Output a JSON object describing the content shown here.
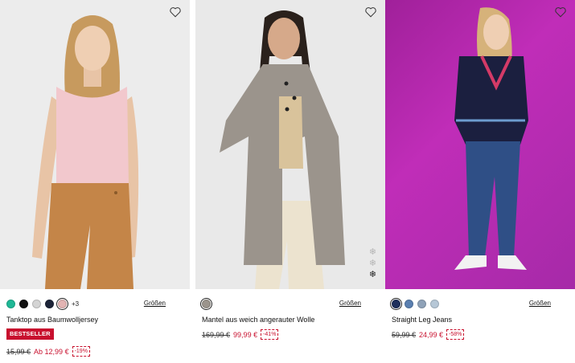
{
  "products": [
    {
      "name": "Tanktop aus Baumwolljersey",
      "image_alt": "Model in pink tank top and camel trousers",
      "swatches": [
        "#1fb896",
        "#111111",
        "#d4d4d4",
        "#1c2438",
        "#e2b4b3"
      ],
      "more_colors": "+3",
      "sizes_label": "Größen",
      "badge": "BESTSELLER",
      "old_price": "15,99 €",
      "new_price": "Ab 12,99 €",
      "discount": "-19%"
    },
    {
      "name": "Mantel aus weich angerauter Wolle",
      "image_alt": "Model in grey wool coat",
      "swatches": [
        "#9b948c"
      ],
      "more_colors": "",
      "sizes_label": "Größen",
      "badge": "",
      "old_price": "169,99 €",
      "new_price": "99,99 €",
      "discount": "-41%",
      "gallery_icons": [
        "snowflake-icon",
        "snowflake-icon",
        "snowflake-icon"
      ]
    },
    {
      "name": "Straight Leg Jeans",
      "image_alt": "Model in navy sweater and straight leg jeans",
      "swatches": [
        "#1e2f5c",
        "#5a7fb0",
        "#8fa2b8",
        "#b6c7d6"
      ],
      "more_colors": "",
      "sizes_label": "Größen",
      "badge": "",
      "old_price": "59,99 €",
      "new_price": "24,99 €",
      "discount": "-58%"
    }
  ],
  "colors": {
    "sale_red": "#c8102e",
    "magenta_bg": "#b02aa8"
  },
  "icons": {
    "wishlist": "heart-outline-icon",
    "gallery": "snowflake-icon"
  }
}
